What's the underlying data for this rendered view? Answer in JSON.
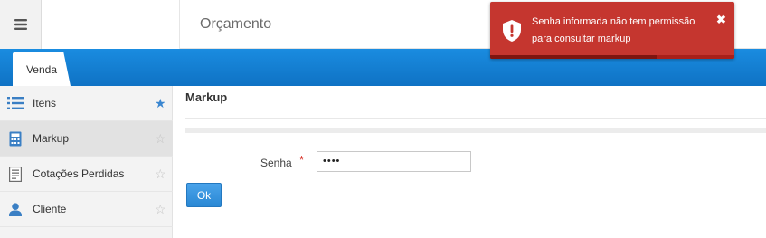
{
  "header": {
    "title": "Orçamento"
  },
  "tabs": [
    {
      "label": "Venda"
    }
  ],
  "sidebar": {
    "items": [
      {
        "label": "Itens",
        "icon": "list-icon",
        "favorite": true
      },
      {
        "label": "Markup",
        "icon": "calculator-icon",
        "favorite": false,
        "active": true
      },
      {
        "label": "Cotações Perdidas",
        "icon": "document-list-icon",
        "favorite": false
      },
      {
        "label": "Cliente",
        "icon": "user-icon",
        "favorite": false
      }
    ]
  },
  "main": {
    "title": "Markup",
    "form": {
      "password_label": "Senha",
      "required_mark": "*",
      "password_value": "••••",
      "ok_label": "Ok"
    }
  },
  "toast": {
    "message_line1": "Senha informada não tem permissão",
    "message_line2": "para consultar markup",
    "close_glyph": "✖",
    "progress": 0.68,
    "color": "#c5362f"
  },
  "colors": {
    "accent": "#1a8ce0",
    "favorite_star": "#3a86d0",
    "error": "#c5362f"
  }
}
